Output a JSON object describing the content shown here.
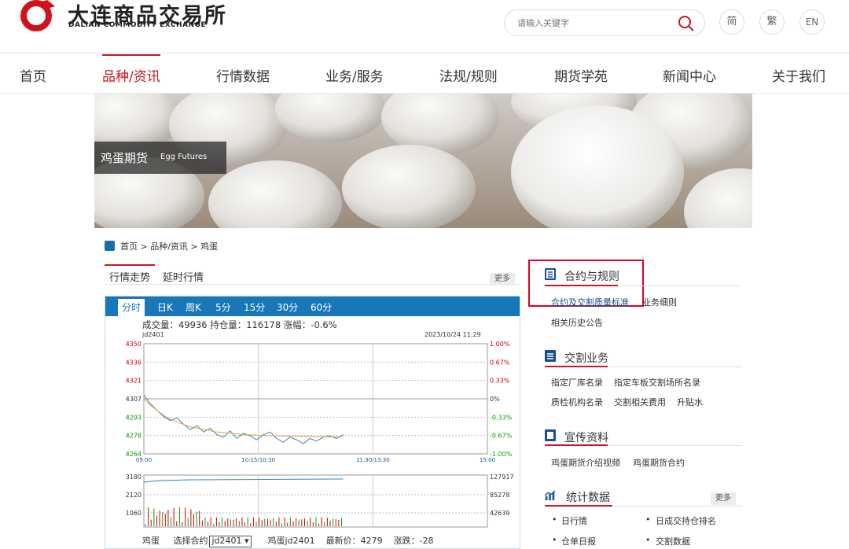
{
  "header": {
    "logo_cn": "大连商品交易所",
    "logo_en": "DALIAN COMMODITY EXCHANGE",
    "search_placeholder": "请输入关键字",
    "lang_simplified": "简",
    "lang_traditional": "繁",
    "lang_english": "EN"
  },
  "nav": {
    "items": [
      "首页",
      "品种/资讯",
      "行情数据",
      "业务/服务",
      "法规/规则",
      "期货学苑",
      "新闻中心",
      "关于我们"
    ],
    "active_index": 1,
    "active_color": "#c8171e"
  },
  "banner": {
    "title_cn": "鸡蛋期货",
    "title_en": "Egg Futures"
  },
  "breadcrumb": "首页 > 品种/资讯 > 鸡蛋",
  "market": {
    "tabs": [
      "行情走势",
      "延时行情"
    ],
    "more": "更多",
    "chart_tabs": [
      "分时",
      "日K",
      "周K",
      "5分",
      "15分",
      "30分",
      "60分"
    ],
    "stats": "成交量：49936   持仓量：116178   涨幅：-0.6%",
    "code": "jd2401",
    "timestamp": "2023/10/24 11:29",
    "footer": {
      "name": "鸡蛋",
      "select_label": "选择合约",
      "select_value": "jd2401",
      "contract": "鸡蛋jd2401",
      "last_price": "最新价：4279",
      "change": "涨跌：-28"
    }
  },
  "chart_data": {
    "type": "line",
    "price_ticks": [
      "4350",
      "4336",
      "4321",
      "4307",
      "4293",
      "4278",
      "4264"
    ],
    "pct_ticks": [
      "1.00%",
      "0.67%",
      "0.33%",
      "0%",
      "-0.33%",
      "-0.67%",
      "-1.00%"
    ],
    "time_ticks": [
      "09:00",
      "10:15/10:30",
      "11:30/13:30",
      "15:00"
    ],
    "volume_ticks": [
      "3180",
      "2120",
      "1060"
    ],
    "oi_ticks": [
      "127917",
      "85278",
      "42639"
    ],
    "series": [
      {
        "values": [
          4310,
          4303,
          4298,
          4293,
          4290,
          4292,
          4287,
          4283,
          4286,
          4281,
          4284,
          4279,
          4277,
          4282,
          4276,
          4280,
          4278,
          4275,
          4279,
          4281,
          4276,
          4273,
          4277,
          4275,
          4272,
          4276,
          4274,
          4277,
          4278,
          4276,
          4279
        ]
      },
      {
        "values": [
          4307,
          4302,
          4298,
          4294,
          4291,
          4289,
          4287,
          4285,
          4284,
          4283,
          4282,
          4281,
          4280.5,
          4280,
          4279.5,
          4279,
          4278.8,
          4278.6,
          4278.4,
          4278.2,
          4278,
          4277.9,
          4277.8,
          4277.7,
          4277.6,
          4277.5,
          4277.4,
          4277.4,
          4277.3,
          4277.3,
          4277.3
        ]
      }
    ],
    "colors": {
      "price": "#2f86c7",
      "avg": "#f0a030",
      "up": "#d00000",
      "down": "#00a000"
    }
  },
  "sidebar": {
    "contract_rules": {
      "title": "合约与规则",
      "links": [
        "合约及交割质量标准",
        "业务细则",
        "相关历史公告"
      ]
    },
    "delivery": {
      "title": "交割业务",
      "links": [
        "指定厂库名录",
        "指定车板交割场所名录",
        "质检机构名录",
        "交割相关费用",
        "升贴水"
      ]
    },
    "promo": {
      "title": "宣传资料",
      "links": [
        "鸡蛋期货介绍视频",
        "鸡蛋期货合约"
      ]
    },
    "stats": {
      "title": "统计数据",
      "more": "更多",
      "links": [
        "日行情",
        "日成交持仓排名",
        "仓单日报",
        "交割数据"
      ]
    }
  }
}
